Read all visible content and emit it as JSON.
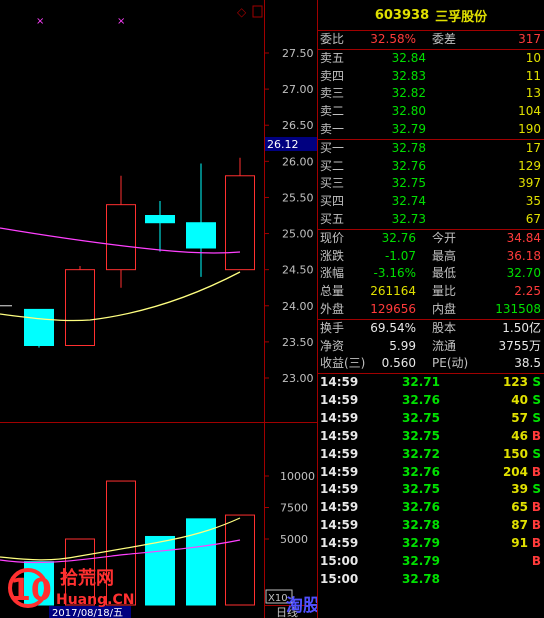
{
  "chart": {
    "price_ticks": [
      "27.50",
      "27.00",
      "26.50",
      "26.00",
      "25.50",
      "25.00",
      "24.50",
      "24.00",
      "23.50",
      "23.00"
    ],
    "current_price_label": "26.12",
    "volume_ticks": [
      "10000",
      "7500",
      "5000"
    ],
    "volume_unit": "X10",
    "date_label": "2017/08/18/五",
    "period_label": "日线",
    "watermark_left": "拾荒网",
    "watermark_left_sub": "Huang.CN",
    "watermark_num": "10",
    "watermark_right": "淘股吧",
    "colors": {
      "up": "#ff3030",
      "down": "#00ffff",
      "ma_yellow": "#ffff80",
      "ma_magenta": "#ff40ff",
      "frame": "#a00000"
    }
  },
  "chart_data": {
    "type": "candlestick",
    "candles": [
      {
        "open": 23.95,
        "close": 23.45,
        "high": 23.95,
        "low": 23.42,
        "volume": 3200
      },
      {
        "open": 23.45,
        "close": 24.5,
        "high": 24.55,
        "low": 23.45,
        "volume": 5000
      },
      {
        "open": 24.5,
        "close": 25.4,
        "high": 25.8,
        "low": 24.25,
        "volume": 9600
      },
      {
        "open": 25.25,
        "close": 25.15,
        "high": 25.45,
        "low": 24.75,
        "volume": 5200
      },
      {
        "open": 25.15,
        "close": 24.8,
        "high": 25.97,
        "low": 24.4,
        "volume": 6600
      },
      {
        "open": 24.5,
        "close": 25.8,
        "high": 26.05,
        "low": 24.5,
        "volume": 6900
      }
    ]
  },
  "quote": {
    "code": "603938",
    "name": "三孚股份",
    "weibi_label": "委比",
    "weibi": "32.58%",
    "weicha_label": "委差",
    "weicha": "317",
    "asks": [
      {
        "label": "卖五",
        "price": "32.84",
        "vol": "10"
      },
      {
        "label": "卖四",
        "price": "32.83",
        "vol": "11"
      },
      {
        "label": "卖三",
        "price": "32.82",
        "vol": "13"
      },
      {
        "label": "卖二",
        "price": "32.80",
        "vol": "104"
      },
      {
        "label": "卖一",
        "price": "32.79",
        "vol": "190"
      }
    ],
    "bids": [
      {
        "label": "买一",
        "price": "32.78",
        "vol": "17"
      },
      {
        "label": "买二",
        "price": "32.76",
        "vol": "129"
      },
      {
        "label": "买三",
        "price": "32.75",
        "vol": "397"
      },
      {
        "label": "买四",
        "price": "32.74",
        "vol": "35"
      },
      {
        "label": "买五",
        "price": "32.73",
        "vol": "67"
      }
    ],
    "stats": {
      "xianjia_label": "现价",
      "xianjia": "32.76",
      "jinkai_label": "今开",
      "jinkai": "34.84",
      "zhangdie_label": "涨跌",
      "zhangdie": "-1.07",
      "zuigao_label": "最高",
      "zuigao": "36.18",
      "zhangfu_label": "涨幅",
      "zhangfu": "-3.16%",
      "zuidi_label": "最低",
      "zuidi": "32.70",
      "zongliang_label": "总量",
      "zongliang": "261164",
      "liangbi_label": "量比",
      "liangbi": "2.25",
      "waipan_label": "外盘",
      "waipan": "129656",
      "neipan_label": "内盘",
      "neipan": "131508",
      "huanshou_label": "换手",
      "huanshou": "69.54%",
      "guben_label": "股本",
      "guben": "1.50亿",
      "jingzi_label": "净资",
      "jingzi": "5.99",
      "liutong_label": "流通",
      "liutong": "3755万",
      "shouyi_label": "收益(三)",
      "shouyi": "0.560",
      "pe_label": "PE(动)",
      "pe": "38.5"
    },
    "ticks": [
      {
        "time": "14:59",
        "price": "32.71",
        "vol": "123",
        "bs": "S",
        "color": "dn"
      },
      {
        "time": "14:59",
        "price": "32.76",
        "vol": "40",
        "bs": "S",
        "color": "dn"
      },
      {
        "time": "14:59",
        "price": "32.75",
        "vol": "57",
        "bs": "S",
        "color": "dn"
      },
      {
        "time": "14:59",
        "price": "32.75",
        "vol": "46",
        "bs": "B",
        "color": "dn"
      },
      {
        "time": "14:59",
        "price": "32.72",
        "vol": "150",
        "bs": "S",
        "color": "dn"
      },
      {
        "time": "14:59",
        "price": "32.76",
        "vol": "204",
        "bs": "B",
        "color": "dn"
      },
      {
        "time": "14:59",
        "price": "32.75",
        "vol": "39",
        "bs": "S",
        "color": "dn"
      },
      {
        "time": "14:59",
        "price": "32.76",
        "vol": "65",
        "bs": "B",
        "color": "dn"
      },
      {
        "time": "14:59",
        "price": "32.78",
        "vol": "87",
        "bs": "B",
        "color": "dn"
      },
      {
        "time": "14:59",
        "price": "32.79",
        "vol": "91",
        "bs": "B",
        "color": "dn"
      },
      {
        "time": "15:00",
        "price": "32.79",
        "vol": "",
        "bs": "B",
        "color": "dn"
      },
      {
        "time": "15:00",
        "price": "32.78",
        "vol": "",
        "bs": "",
        "color": "dn"
      }
    ]
  }
}
